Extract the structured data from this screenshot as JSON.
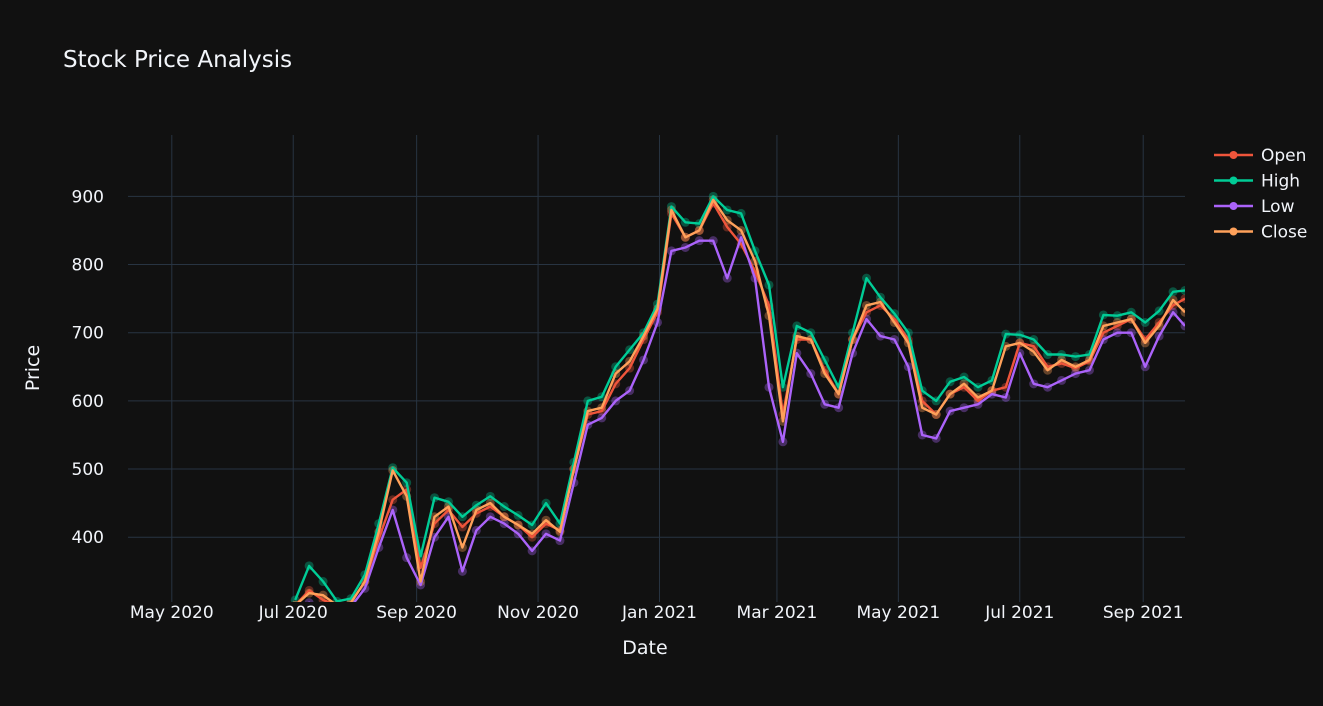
{
  "chart_data": {
    "type": "line",
    "title": "Stock Price Analysis",
    "xlabel": "Date",
    "ylabel": "Price",
    "xlim": [
      "2020-04-09",
      "2021-09-22"
    ],
    "ylim": [
      305,
      990
    ],
    "x_ticks": [
      {
        "date": "2020-05-01",
        "label": "May 2020"
      },
      {
        "date": "2020-07-01",
        "label": "Jul 2020"
      },
      {
        "date": "2020-09-01",
        "label": "Sep 2020"
      },
      {
        "date": "2020-11-01",
        "label": "Nov 2020"
      },
      {
        "date": "2021-01-01",
        "label": "Jan 2021"
      },
      {
        "date": "2021-03-01",
        "label": "Mar 2021"
      },
      {
        "date": "2021-05-01",
        "label": "May 2021"
      },
      {
        "date": "2021-07-01",
        "label": "Jul 2021"
      },
      {
        "date": "2021-09-01",
        "label": "Sep 2021"
      }
    ],
    "y_ticks": [
      400,
      500,
      600,
      700,
      800,
      900
    ],
    "grid": true,
    "legend_position": "top-right",
    "x": [
      "2020-07-02",
      "2020-07-09",
      "2020-07-16",
      "2020-07-23",
      "2020-07-30",
      "2020-08-06",
      "2020-08-13",
      "2020-08-20",
      "2020-08-27",
      "2020-09-03",
      "2020-09-10",
      "2020-09-17",
      "2020-09-24",
      "2020-10-01",
      "2020-10-08",
      "2020-10-15",
      "2020-10-22",
      "2020-10-29",
      "2020-11-05",
      "2020-11-12",
      "2020-11-19",
      "2020-11-26",
      "2020-12-03",
      "2020-12-10",
      "2020-12-17",
      "2020-12-24",
      "2020-12-31",
      "2021-01-07",
      "2021-01-14",
      "2021-01-21",
      "2021-01-28",
      "2021-02-04",
      "2021-02-11",
      "2021-02-18",
      "2021-02-25",
      "2021-03-04",
      "2021-03-11",
      "2021-03-18",
      "2021-03-25",
      "2021-04-01",
      "2021-04-08",
      "2021-04-15",
      "2021-04-22",
      "2021-04-29",
      "2021-05-06",
      "2021-05-13",
      "2021-05-20",
      "2021-05-27",
      "2021-06-03",
      "2021-06-10",
      "2021-06-17",
      "2021-06-24",
      "2021-07-01",
      "2021-07-08",
      "2021-07-15",
      "2021-07-22",
      "2021-07-29",
      "2021-08-05",
      "2021-08-12",
      "2021-08-19",
      "2021-08-26",
      "2021-09-02",
      "2021-09-09",
      "2021-09-16",
      "2021-09-22"
    ],
    "series": [
      {
        "name": "Open",
        "color": "#EF553B",
        "values": [
          300,
          322,
          308,
          300,
          304,
          335,
          398,
          455,
          470,
          355,
          420,
          440,
          415,
          435,
          445,
          430,
          418,
          400,
          420,
          410,
          500,
          580,
          585,
          625,
          648,
          690,
          730,
          875,
          840,
          850,
          890,
          855,
          830,
          790,
          740,
          580,
          690,
          690,
          645,
          610,
          690,
          730,
          740,
          720,
          690,
          600,
          580,
          610,
          620,
          600,
          615,
          620,
          685,
          680,
          650,
          655,
          648,
          658,
          700,
          710,
          720,
          690,
          715,
          740,
          750
        ]
      },
      {
        "name": "High",
        "color": "#00CC96",
        "values": [
          308,
          358,
          335,
          306,
          310,
          345,
          420,
          502,
          480,
          372,
          458,
          452,
          430,
          447,
          460,
          445,
          432,
          418,
          450,
          420,
          510,
          600,
          606,
          650,
          675,
          700,
          742,
          885,
          862,
          860,
          900,
          880,
          875,
          820,
          770,
          620,
          710,
          700,
          660,
          620,
          700,
          780,
          752,
          728,
          700,
          615,
          600,
          628,
          635,
          620,
          630,
          698,
          697,
          690,
          668,
          668,
          665,
          668,
          726,
          725,
          730,
          715,
          732,
          760,
          762
        ]
      },
      {
        "name": "Low",
        "color": "#AB63FA",
        "values": [
          290,
          304,
          295,
          292,
          298,
          325,
          385,
          440,
          370,
          330,
          400,
          430,
          350,
          410,
          430,
          420,
          405,
          380,
          405,
          395,
          480,
          565,
          575,
          600,
          615,
          660,
          715,
          820,
          825,
          835,
          835,
          780,
          840,
          780,
          620,
          540,
          670,
          640,
          595,
          590,
          670,
          720,
          695,
          690,
          650,
          550,
          545,
          585,
          590,
          595,
          610,
          605,
          670,
          625,
          620,
          630,
          640,
          645,
          690,
          700,
          700,
          650,
          695,
          730,
          710
        ]
      },
      {
        "name": "Close",
        "color": "#FFA15A",
        "values": [
          300,
          318,
          315,
          300,
          304,
          335,
          408,
          498,
          460,
          335,
          430,
          445,
          385,
          440,
          450,
          430,
          418,
          405,
          425,
          408,
          500,
          585,
          590,
          640,
          658,
          695,
          735,
          880,
          840,
          850,
          895,
          865,
          850,
          805,
          725,
          570,
          695,
          690,
          640,
          610,
          690,
          740,
          745,
          715,
          685,
          590,
          580,
          610,
          625,
          605,
          615,
          680,
          685,
          672,
          645,
          660,
          650,
          660,
          710,
          715,
          720,
          685,
          710,
          748,
          730
        ]
      }
    ]
  }
}
